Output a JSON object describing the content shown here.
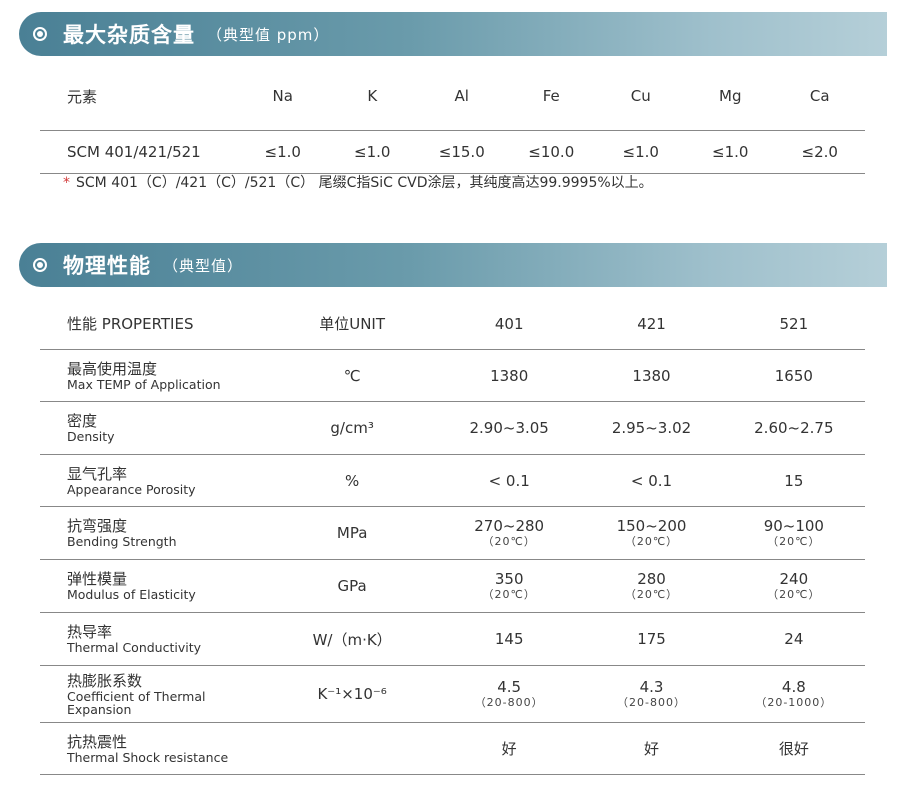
{
  "impurity": {
    "title": "最大杂质含量",
    "subtitle": "（典型值 ppm）",
    "headers": [
      "元素",
      "Na",
      "K",
      "Al",
      "Fe",
      "Cu",
      "Mg",
      "Ca"
    ],
    "row": [
      "SCM 401/421/521",
      "≤1.0",
      "≤1.0",
      "≤15.0",
      "≤10.0",
      "≤1.0",
      "≤1.0",
      "≤2.0"
    ],
    "note_mark": "*",
    "note": "SCM 401（C）/421（C）/521（C） 尾缀C指SiC CVD涂层，其纯度高达99.9995%以上。"
  },
  "physical": {
    "title": "物理性能",
    "subtitle": "（典型值）",
    "headers": [
      "性能 PROPERTIES",
      "单位UNIT",
      "401",
      "421",
      "521"
    ],
    "rows": [
      {
        "zh": "最高使用温度",
        "en": "Max TEMP of Application",
        "unit": "℃",
        "v": [
          {
            "m": "1380",
            "s": ""
          },
          {
            "m": "1380",
            "s": ""
          },
          {
            "m": "1650",
            "s": ""
          }
        ]
      },
      {
        "zh": "密度",
        "en": "Density",
        "unit": "g/cm³",
        "v": [
          {
            "m": "2.90~3.05",
            "s": ""
          },
          {
            "m": "2.95~3.02",
            "s": ""
          },
          {
            "m": "2.60~2.75",
            "s": ""
          }
        ]
      },
      {
        "zh": "显气孔率",
        "en": "Appearance Porosity",
        "unit": "%",
        "v": [
          {
            "m": "< 0.1",
            "s": ""
          },
          {
            "m": "< 0.1",
            "s": ""
          },
          {
            "m": "15",
            "s": ""
          }
        ]
      },
      {
        "zh": "抗弯强度",
        "en": "Bending Strength",
        "unit": "MPa",
        "v": [
          {
            "m": "270~280",
            "s": "（20℃）"
          },
          {
            "m": "150~200",
            "s": "（20℃）"
          },
          {
            "m": "90~100",
            "s": "（20℃）"
          }
        ]
      },
      {
        "zh": "弹性模量",
        "en": "Modulus of Elasticity",
        "unit": "GPa",
        "v": [
          {
            "m": "350",
            "s": "（20℃）"
          },
          {
            "m": "280",
            "s": "（20℃）"
          },
          {
            "m": "240",
            "s": "（20℃）"
          }
        ]
      },
      {
        "zh": "热导率",
        "en": "Thermal Conductivity",
        "unit": "W/（m·K）",
        "v": [
          {
            "m": "145",
            "s": ""
          },
          {
            "m": "175",
            "s": ""
          },
          {
            "m": "24",
            "s": ""
          }
        ]
      },
      {
        "zh": "热膨胀系数",
        "en": "Coefficient of Thermal Expansion",
        "unit": "K⁻¹×10⁻⁶",
        "v": [
          {
            "m": "4.5",
            "s": "（20-800）"
          },
          {
            "m": "4.3",
            "s": "（20-800）"
          },
          {
            "m": "4.8",
            "s": "（20-1000）"
          }
        ]
      },
      {
        "zh": "抗热震性",
        "en": "Thermal Shock resistance",
        "unit": "",
        "v": [
          {
            "m": "好",
            "s": ""
          },
          {
            "m": "好",
            "s": ""
          },
          {
            "m": "很好",
            "s": ""
          }
        ]
      }
    ]
  }
}
